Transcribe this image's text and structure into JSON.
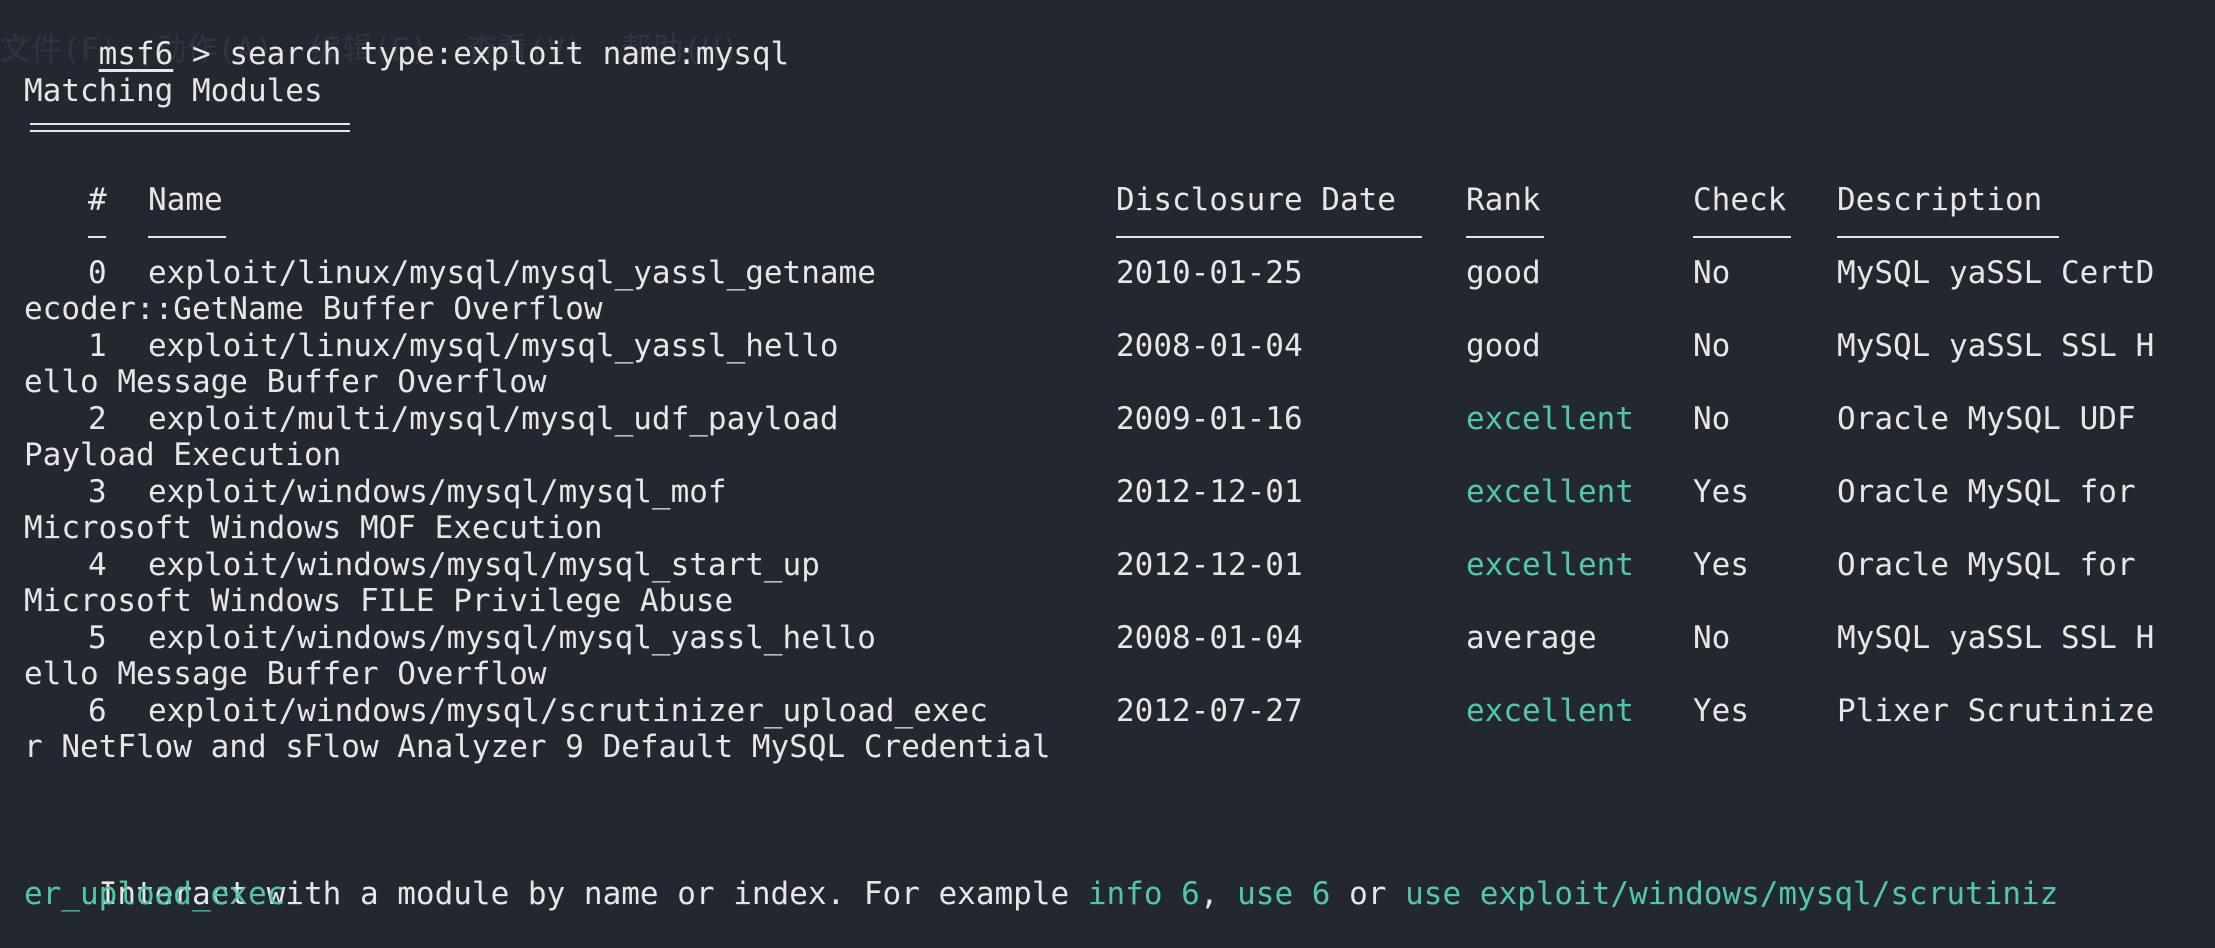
{
  "prompt": {
    "name": "msf6",
    "sep": " > ",
    "command": "search type:exploit name:mysql"
  },
  "heading": "Matching Modules",
  "columns": {
    "num": "#",
    "name": "Name",
    "date": "Disclosure Date",
    "rank": "Rank",
    "check": "Check",
    "desc": "Description"
  },
  "rows": [
    {
      "num": "0",
      "name": "exploit/linux/mysql/mysql_yassl_getname",
      "date": "2010-01-25",
      "rank": "good",
      "check": "No",
      "desc": "MySQL yaSSL CertD",
      "wrap": "ecoder::GetName Buffer Overflow"
    },
    {
      "num": "1",
      "name": "exploit/linux/mysql/mysql_yassl_hello",
      "date": "2008-01-04",
      "rank": "good",
      "check": "No",
      "desc": "MySQL yaSSL SSL H",
      "wrap": "ello Message Buffer Overflow"
    },
    {
      "num": "2",
      "name": "exploit/multi/mysql/mysql_udf_payload",
      "date": "2009-01-16",
      "rank": "excellent",
      "check": "No",
      "desc": "Oracle MySQL UDF",
      "wrap": "Payload Execution"
    },
    {
      "num": "3",
      "name": "exploit/windows/mysql/mysql_mof",
      "date": "2012-12-01",
      "rank": "excellent",
      "check": "Yes",
      "desc": "Oracle MySQL for",
      "wrap": "Microsoft Windows MOF Execution"
    },
    {
      "num": "4",
      "name": "exploit/windows/mysql/mysql_start_up",
      "date": "2012-12-01",
      "rank": "excellent",
      "check": "Yes",
      "desc": "Oracle MySQL for",
      "wrap": "Microsoft Windows FILE Privilege Abuse"
    },
    {
      "num": "5",
      "name": "exploit/windows/mysql/mysql_yassl_hello",
      "date": "2008-01-04",
      "rank": "average",
      "check": "No",
      "desc": "MySQL yaSSL SSL H",
      "wrap": "ello Message Buffer Overflow"
    },
    {
      "num": "6",
      "name": "exploit/windows/mysql/scrutinizer_upload_exec",
      "date": "2012-07-27",
      "rank": "excellent",
      "check": "Yes",
      "desc": "Plixer Scrutinize",
      "wrap": "r NetFlow and sFlow Analyzer 9 Default MySQL Credential"
    }
  ],
  "footer": {
    "pre": "Interact with a module by name or index. For example ",
    "info": "info 6",
    "comma": ", ",
    "use": "use 6",
    "or": " or ",
    "use_path": "use exploit/windows/mysql/scrutiniz",
    "wrap": "er_upload_exec"
  },
  "colors": {
    "background": "#232730",
    "text": "#e6e6e6",
    "accent": "#52c7a6"
  }
}
